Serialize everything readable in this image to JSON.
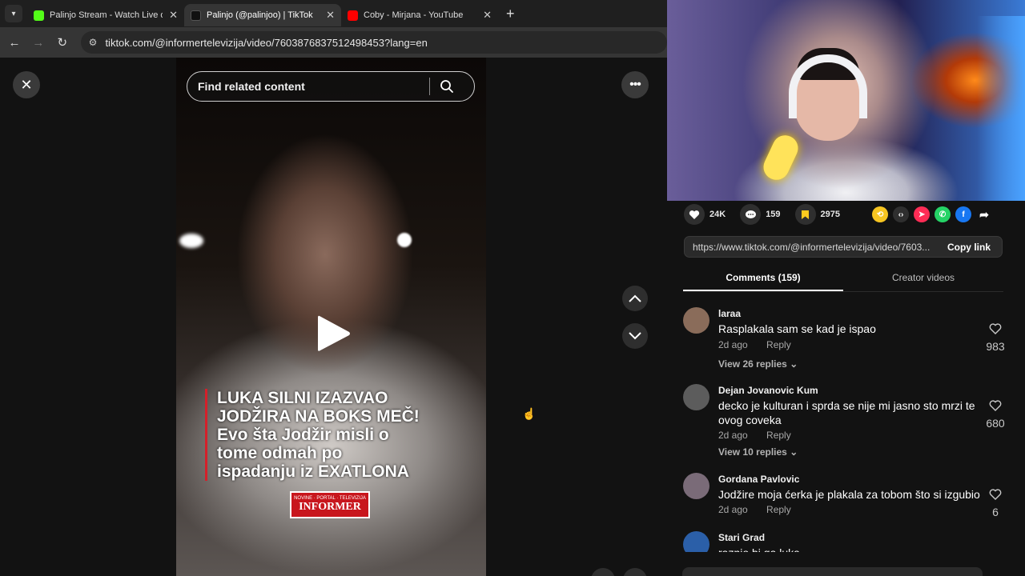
{
  "browser": {
    "tabs": [
      {
        "title": "Palinjo Stream - Watch Live on Kick",
        "favicon_color": "#53fc18",
        "active": false
      },
      {
        "title": "Palinjo (@palinjoo) | TikTok",
        "favicon_color": "#111111",
        "active": true
      },
      {
        "title": "Coby - Mirjana - YouTube",
        "favicon_color": "#ff0000",
        "active": false
      }
    ],
    "new_tab": "+",
    "url": "tiktok.com/@informertelevizija/video/7603876837512498453?lang=en"
  },
  "player": {
    "search_placeholder": "Find related content",
    "caption_lines": [
      "LUKA SILNI IZAZVAO",
      "JODŽIRA NA BOKS MEČ!",
      "Evo šta Jodžir misli o",
      "tome odmah po",
      "ispadanju iz EXATLONA"
    ],
    "logo_top": "NOVINE · PORTAL · TELEVIZIJA",
    "logo_main": "INFORMER"
  },
  "actions": {
    "likes": "24K",
    "comments": "159",
    "saves": "2975",
    "share_icons": [
      "repost-icon",
      "embed-icon",
      "send-icon",
      "whatsapp-icon",
      "facebook-icon",
      "share-arrow-icon"
    ]
  },
  "link": {
    "url": "https://www.tiktok.com/@informertelevizija/video/7603...",
    "copy_label": "Copy link"
  },
  "tabs": {
    "comments": "Comments (159)",
    "creator": "Creator videos"
  },
  "comments": [
    {
      "user": "laraa",
      "text": "Rasplakala sam se kad je ispao",
      "date": "2d ago",
      "reply": "Reply",
      "likes": "983",
      "replies": "View 26 replies",
      "avatar_color": "#8a6c5a"
    },
    {
      "user": "Dejan Jovanovic Kum",
      "text": "decko je kulturan i sprda se nije mi jasno sto mrzi te ovog coveka",
      "date": "2d ago",
      "reply": "Reply",
      "likes": "680",
      "replies": "View 10 replies",
      "avatar_color": "#5c5c5c"
    },
    {
      "user": "Gordana Pavlovic",
      "text": "Jodžire moja ćerka je plakala za tobom što si izgubio",
      "date": "2d ago",
      "reply": "Reply",
      "likes": "6",
      "avatar_color": "#7a6b78"
    },
    {
      "user": "Stari Grad",
      "text": "raznio bi ga luka",
      "avatar_color": "#2b5fa8"
    }
  ]
}
